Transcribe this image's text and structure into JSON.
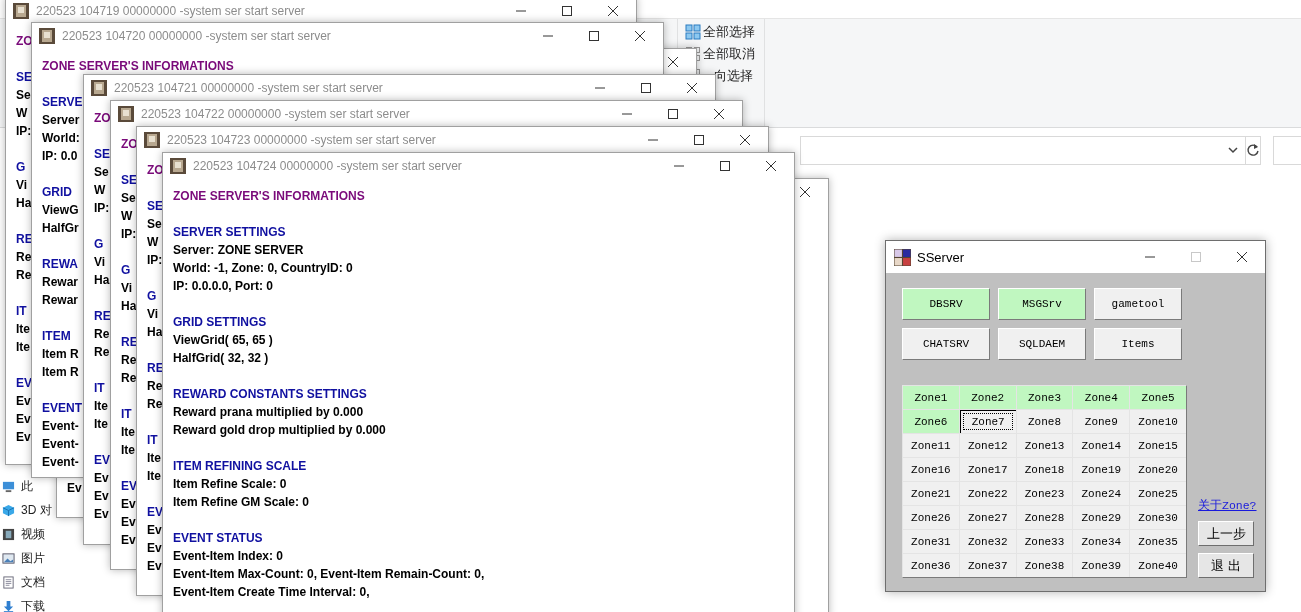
{
  "explorer": {
    "ribbon_items": [
      {
        "label": "全部选择"
      },
      {
        "label": "全部取消"
      },
      {
        "label": "向选择"
      }
    ],
    "sidebar_items": [
      {
        "label": "此"
      },
      {
        "label": "3D 对"
      },
      {
        "label": "视频"
      },
      {
        "label": "图片"
      },
      {
        "label": "文档"
      },
      {
        "label": "下载"
      }
    ]
  },
  "back_window": {
    "lines": [
      {
        "kind": "gap"
      },
      {
        "kind": "gap"
      },
      {
        "kind": "gap"
      },
      {
        "kind": "gap"
      },
      {
        "kind": "gap"
      },
      {
        "kind": "gap"
      },
      {
        "kind": "gap"
      },
      {
        "kind": "gap"
      },
      {
        "kind": "gap"
      },
      {
        "kind": "gap"
      },
      {
        "kind": "gap"
      },
      {
        "kind": "gap"
      },
      {
        "kind": "gap"
      },
      {
        "kind": "gap"
      },
      {
        "kind": "gap"
      },
      {
        "kind": "gap"
      },
      {
        "kind": "gap"
      },
      {
        "kind": "gap"
      },
      {
        "kind": "gap"
      },
      {
        "kind": "gap"
      },
      {
        "kind": "gap"
      },
      {
        "kind": "gap"
      },
      {
        "kind": "text",
        "text": "Ev"
      }
    ]
  },
  "console_windows": [
    {
      "title": "220523 104719 00000000 -system ser start server",
      "lines": [
        {
          "kind": "title",
          "text": "ZO"
        },
        {
          "kind": "gap"
        },
        {
          "kind": "heading",
          "text": "SE"
        },
        {
          "kind": "text",
          "text": "Se"
        },
        {
          "kind": "text",
          "text": "W"
        },
        {
          "kind": "text",
          "text": "IP:"
        },
        {
          "kind": "gap"
        },
        {
          "kind": "heading",
          "text": "G"
        },
        {
          "kind": "text",
          "text": "Vi"
        },
        {
          "kind": "text",
          "text": "Ha"
        },
        {
          "kind": "gap"
        },
        {
          "kind": "heading",
          "text": "RE"
        },
        {
          "kind": "text",
          "text": "Re"
        },
        {
          "kind": "text",
          "text": "Re"
        },
        {
          "kind": "gap"
        },
        {
          "kind": "heading",
          "text": "IT"
        },
        {
          "kind": "text",
          "text": "Ite"
        },
        {
          "kind": "text",
          "text": "Ite"
        },
        {
          "kind": "gap"
        },
        {
          "kind": "heading",
          "text": "EV"
        },
        {
          "kind": "text",
          "text": "Ev"
        },
        {
          "kind": "text",
          "text": "Ev"
        },
        {
          "kind": "text",
          "text": "Ev"
        }
      ]
    },
    {
      "title": "220523 104720 00000000 -system ser start server",
      "lines": [
        {
          "kind": "title",
          "text": "ZONE SERVER'S INFORMATIONS"
        },
        {
          "kind": "gap"
        },
        {
          "kind": "heading",
          "text": "SERVE"
        },
        {
          "kind": "text",
          "text": "Server"
        },
        {
          "kind": "text",
          "text": "World:"
        },
        {
          "kind": "text",
          "text": "IP: 0.0"
        },
        {
          "kind": "gap"
        },
        {
          "kind": "heading",
          "text": "GRID"
        },
        {
          "kind": "text",
          "text": "ViewG"
        },
        {
          "kind": "text",
          "text": "HalfGr"
        },
        {
          "kind": "gap"
        },
        {
          "kind": "heading",
          "text": "REWA"
        },
        {
          "kind": "text",
          "text": "Rewar"
        },
        {
          "kind": "text",
          "text": "Rewar"
        },
        {
          "kind": "gap"
        },
        {
          "kind": "heading",
          "text": "ITEM"
        },
        {
          "kind": "text",
          "text": "Item R"
        },
        {
          "kind": "text",
          "text": "Item R"
        },
        {
          "kind": "gap"
        },
        {
          "kind": "heading",
          "text": "EVENT"
        },
        {
          "kind": "text",
          "text": "Event-"
        },
        {
          "kind": "text",
          "text": "Event-"
        },
        {
          "kind": "text",
          "text": "Event-"
        }
      ]
    },
    {
      "title": "220523 104721 00000000 -system ser start server",
      "lines": [
        {
          "kind": "title",
          "text": "ZO"
        },
        {
          "kind": "gap"
        },
        {
          "kind": "heading",
          "text": "SE"
        },
        {
          "kind": "text",
          "text": "Se"
        },
        {
          "kind": "text",
          "text": "W"
        },
        {
          "kind": "text",
          "text": "IP:"
        },
        {
          "kind": "gap"
        },
        {
          "kind": "heading",
          "text": "G"
        },
        {
          "kind": "text",
          "text": "Vi"
        },
        {
          "kind": "text",
          "text": "Ha"
        },
        {
          "kind": "gap"
        },
        {
          "kind": "heading",
          "text": "RE"
        },
        {
          "kind": "text",
          "text": "Re"
        },
        {
          "kind": "text",
          "text": "Re"
        },
        {
          "kind": "gap"
        },
        {
          "kind": "heading",
          "text": "IT"
        },
        {
          "kind": "text",
          "text": "Ite"
        },
        {
          "kind": "text",
          "text": "Ite"
        },
        {
          "kind": "gap"
        },
        {
          "kind": "heading",
          "text": "EV"
        },
        {
          "kind": "text",
          "text": "Ev"
        },
        {
          "kind": "text",
          "text": "Ev"
        },
        {
          "kind": "text",
          "text": "Ev"
        }
      ]
    },
    {
      "title": "220523 104722 00000000 -system ser start server",
      "lines": [
        {
          "kind": "title",
          "text": "ZO"
        },
        {
          "kind": "gap"
        },
        {
          "kind": "heading",
          "text": "SE"
        },
        {
          "kind": "text",
          "text": "Se"
        },
        {
          "kind": "text",
          "text": "W"
        },
        {
          "kind": "text",
          "text": "IP:"
        },
        {
          "kind": "gap"
        },
        {
          "kind": "heading",
          "text": "G"
        },
        {
          "kind": "text",
          "text": "Vi"
        },
        {
          "kind": "text",
          "text": "Ha"
        },
        {
          "kind": "gap"
        },
        {
          "kind": "heading",
          "text": "RE"
        },
        {
          "kind": "text",
          "text": "Re"
        },
        {
          "kind": "text",
          "text": "Re"
        },
        {
          "kind": "gap"
        },
        {
          "kind": "heading",
          "text": "IT"
        },
        {
          "kind": "text",
          "text": "Ite"
        },
        {
          "kind": "text",
          "text": "Ite"
        },
        {
          "kind": "gap"
        },
        {
          "kind": "heading",
          "text": "EV"
        },
        {
          "kind": "text",
          "text": "Ev"
        },
        {
          "kind": "text",
          "text": "Ev"
        },
        {
          "kind": "text",
          "text": "Ev"
        }
      ]
    },
    {
      "title": "220523 104723 00000000 -system ser start server",
      "lines": [
        {
          "kind": "title",
          "text": "ZO"
        },
        {
          "kind": "gap"
        },
        {
          "kind": "heading",
          "text": "SE"
        },
        {
          "kind": "text",
          "text": "Se"
        },
        {
          "kind": "text",
          "text": "W"
        },
        {
          "kind": "text",
          "text": "IP:"
        },
        {
          "kind": "gap"
        },
        {
          "kind": "heading",
          "text": "G"
        },
        {
          "kind": "text",
          "text": "Vi"
        },
        {
          "kind": "text",
          "text": "Ha"
        },
        {
          "kind": "gap"
        },
        {
          "kind": "heading",
          "text": "RE"
        },
        {
          "kind": "text",
          "text": "Re"
        },
        {
          "kind": "text",
          "text": "Re"
        },
        {
          "kind": "gap"
        },
        {
          "kind": "heading",
          "text": "IT"
        },
        {
          "kind": "text",
          "text": "Ite"
        },
        {
          "kind": "text",
          "text": "Ite"
        },
        {
          "kind": "gap"
        },
        {
          "kind": "heading",
          "text": "EV"
        },
        {
          "kind": "text",
          "text": "Ev"
        },
        {
          "kind": "text",
          "text": "Ev"
        },
        {
          "kind": "text",
          "text": "Ev"
        }
      ]
    },
    {
      "title": "220523 104724 00000000 -system ser start server",
      "lines": [
        {
          "kind": "title",
          "text": "ZONE SERVER'S INFORMATIONS"
        },
        {
          "kind": "gap"
        },
        {
          "kind": "heading",
          "text": "SERVER SETTINGS"
        },
        {
          "kind": "text",
          "text": "Server: ZONE SERVER"
        },
        {
          "kind": "text",
          "text": "World: -1, Zone: 0, CountryID: 0"
        },
        {
          "kind": "text",
          "text": "IP: 0.0.0.0, Port: 0"
        },
        {
          "kind": "gap"
        },
        {
          "kind": "heading",
          "text": "GRID SETTINGS"
        },
        {
          "kind": "text",
          "text": "ViewGrid( 65, 65 )"
        },
        {
          "kind": "text",
          "text": "HalfGrid( 32, 32 )"
        },
        {
          "kind": "gap"
        },
        {
          "kind": "heading",
          "text": "REWARD CONSTANTS SETTINGS"
        },
        {
          "kind": "text",
          "text": "Reward prana multiplied by 0.000"
        },
        {
          "kind": "text",
          "text": "Reward gold drop multiplied by 0.000"
        },
        {
          "kind": "gap"
        },
        {
          "kind": "heading",
          "text": "ITEM REFINING SCALE"
        },
        {
          "kind": "text",
          "text": "Item Refine Scale: 0"
        },
        {
          "kind": "text",
          "text": "Item Refine GM Scale: 0"
        },
        {
          "kind": "gap"
        },
        {
          "kind": "heading",
          "text": "EVENT STATUS"
        },
        {
          "kind": "text",
          "text": "Event-Item Index: 0"
        },
        {
          "kind": "text",
          "text": "Event-Item Max-Count: 0, Event-Item Remain-Count: 0,"
        },
        {
          "kind": "text",
          "text": "Event-Item Create Time Interval: 0,"
        }
      ]
    }
  ],
  "sserver": {
    "title": "SServer",
    "buttons": [
      {
        "label": "DBSRV",
        "on": true
      },
      {
        "label": "MSGSrv",
        "on": true
      },
      {
        "label": "gametool",
        "on": false
      },
      {
        "label": "CHATSRV",
        "on": false
      },
      {
        "label": "SQLDAEM",
        "on": false
      },
      {
        "label": "Items",
        "on": false
      }
    ],
    "zones": [
      {
        "label": "Zone1",
        "on": true,
        "focused": false
      },
      {
        "label": "Zone2",
        "on": true,
        "focused": false
      },
      {
        "label": "Zone3",
        "on": true,
        "focused": false
      },
      {
        "label": "Zone4",
        "on": true,
        "focused": false
      },
      {
        "label": "Zone5",
        "on": true,
        "focused": false
      },
      {
        "label": "Zone6",
        "on": true,
        "focused": false
      },
      {
        "label": "Zone7",
        "on": false,
        "focused": true
      },
      {
        "label": "Zone8",
        "on": false,
        "focused": false
      },
      {
        "label": "Zone9",
        "on": false,
        "focused": false
      },
      {
        "label": "Zone10",
        "on": false,
        "focused": false
      },
      {
        "label": "Zone11",
        "on": false,
        "focused": false
      },
      {
        "label": "Zone12",
        "on": false,
        "focused": false
      },
      {
        "label": "Zone13",
        "on": false,
        "focused": false
      },
      {
        "label": "Zone14",
        "on": false,
        "focused": false
      },
      {
        "label": "Zone15",
        "on": false,
        "focused": false
      },
      {
        "label": "Zone16",
        "on": false,
        "focused": false
      },
      {
        "label": "Zone17",
        "on": false,
        "focused": false
      },
      {
        "label": "Zone18",
        "on": false,
        "focused": false
      },
      {
        "label": "Zone19",
        "on": false,
        "focused": false
      },
      {
        "label": "Zone20",
        "on": false,
        "focused": false
      },
      {
        "label": "Zone21",
        "on": false,
        "focused": false
      },
      {
        "label": "Zone22",
        "on": false,
        "focused": false
      },
      {
        "label": "Zone23",
        "on": false,
        "focused": false
      },
      {
        "label": "Zone24",
        "on": false,
        "focused": false
      },
      {
        "label": "Zone25",
        "on": false,
        "focused": false
      },
      {
        "label": "Zone26",
        "on": false,
        "focused": false
      },
      {
        "label": "Zone27",
        "on": false,
        "focused": false
      },
      {
        "label": "Zone28",
        "on": false,
        "focused": false
      },
      {
        "label": "Zone29",
        "on": false,
        "focused": false
      },
      {
        "label": "Zone30",
        "on": false,
        "focused": false
      },
      {
        "label": "Zone31",
        "on": false,
        "focused": false
      },
      {
        "label": "Zone32",
        "on": false,
        "focused": false
      },
      {
        "label": "Zone33",
        "on": false,
        "focused": false
      },
      {
        "label": "Zone34",
        "on": false,
        "focused": false
      },
      {
        "label": "Zone35",
        "on": false,
        "focused": false
      },
      {
        "label": "Zone36",
        "on": false,
        "focused": false
      },
      {
        "label": "Zone37",
        "on": false,
        "focused": false
      },
      {
        "label": "Zone38",
        "on": false,
        "focused": false
      },
      {
        "label": "Zone39",
        "on": false,
        "focused": false
      },
      {
        "label": "Zone40",
        "on": false,
        "focused": false
      }
    ],
    "link": "关于Zone?",
    "actions": [
      "上一步",
      "退 出"
    ]
  }
}
